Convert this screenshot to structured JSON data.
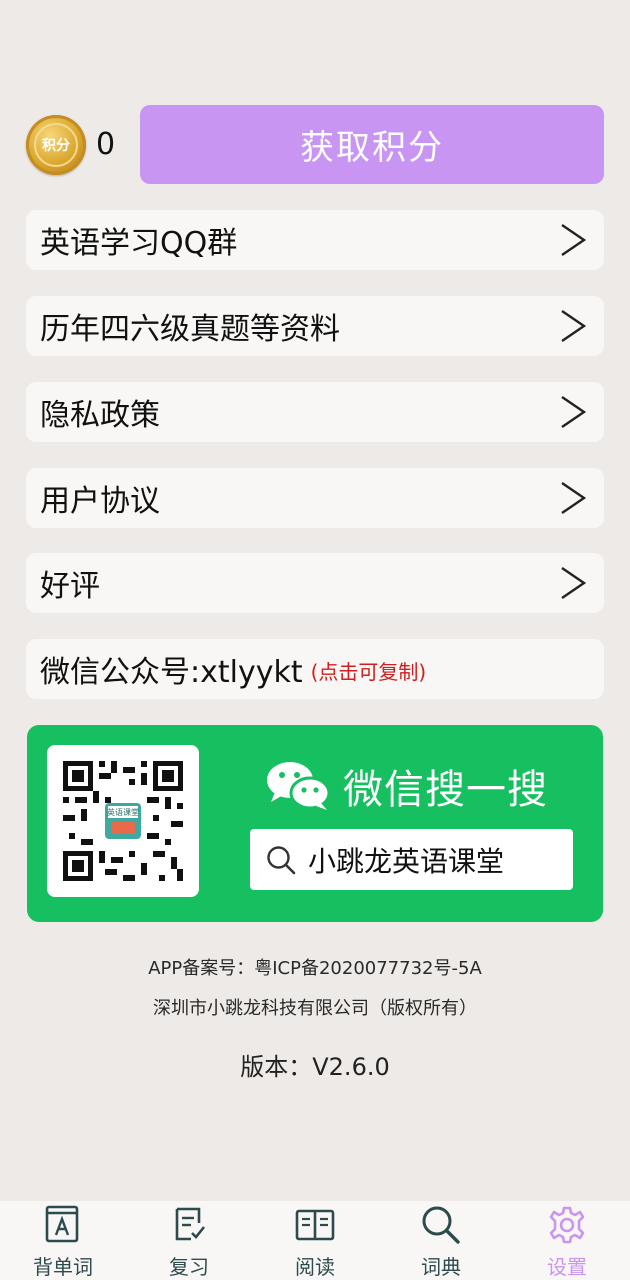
{
  "points": {
    "coin_label": "积分",
    "count": "0",
    "get_button": "获取积分"
  },
  "menu": [
    {
      "label": "英语学习QQ群"
    },
    {
      "label": "历年四六级真题等资料"
    },
    {
      "label": "隐私政策"
    },
    {
      "label": "用户协议"
    },
    {
      "label": "好评"
    }
  ],
  "wechat_account": {
    "label": "微信公众号:xtlyykt",
    "copy_hint": "(点击可复制)"
  },
  "wechat_card": {
    "title": "微信搜一搜",
    "search_text": "小跳龙英语课堂",
    "qr_caption": "英语课堂"
  },
  "footer": {
    "icp": "APP备案号：粤ICP备2020077732号-5A",
    "company": "深圳市小跳龙科技有限公司（版权所有）",
    "version": "版本：V2.6.0"
  },
  "tabs": [
    {
      "label": "背单词",
      "icon": "flashcard-icon"
    },
    {
      "label": "复习",
      "icon": "review-icon"
    },
    {
      "label": "阅读",
      "icon": "book-icon"
    },
    {
      "label": "词典",
      "icon": "search-icon"
    },
    {
      "label": "设置",
      "icon": "gear-icon",
      "active": true
    }
  ],
  "colors": {
    "accent": "#c995f2",
    "wechat_green": "#16c060",
    "background": "#edeae7",
    "tab_icon": "#2d4a4c"
  }
}
